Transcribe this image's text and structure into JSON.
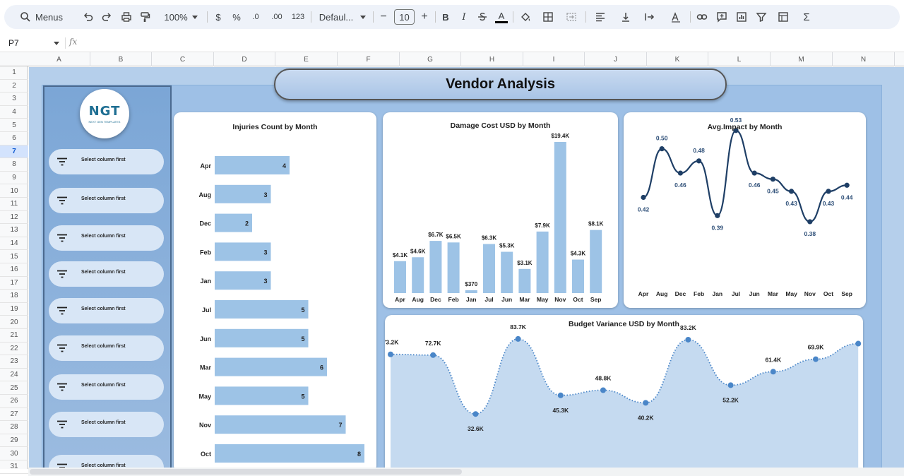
{
  "toolbar": {
    "search_label": "Menus",
    "zoom": "100%",
    "currency": "$",
    "percent": "%",
    "dec_decrease": ".0",
    "dec_increase": ".00",
    "number_format": "123",
    "font": "Defaul...",
    "font_size": "10",
    "bold": "B",
    "italic": "I",
    "text_color": "A",
    "sum": "Σ"
  },
  "formula_bar": {
    "cell": "P7",
    "fx": "fx"
  },
  "columns": [
    "A",
    "B",
    "C",
    "D",
    "E",
    "F",
    "G",
    "H",
    "I",
    "J",
    "K",
    "L",
    "M",
    "N"
  ],
  "rows": [
    "1",
    "2",
    "3",
    "4",
    "5",
    "6",
    "7",
    "8",
    "9",
    "10",
    "11",
    "12",
    "13",
    "14",
    "15",
    "16",
    "17",
    "18",
    "19",
    "20",
    "21",
    "22",
    "23",
    "24",
    "25",
    "26",
    "27",
    "28",
    "29",
    "30",
    "31"
  ],
  "active_row": "7",
  "dashboard": {
    "title": "Vendor Analysis",
    "logo_text": "NGT",
    "logo_subtext": "NEXT GEN TEMPLATES",
    "filters": [
      "Select column first",
      "Select column first",
      "Select column first",
      "Select column first",
      "Select column first",
      "Select column first",
      "Select column first",
      "Select column first",
      "Select column first"
    ]
  },
  "chart_data": [
    {
      "type": "bar",
      "orientation": "horizontal",
      "title": "Injuries Count by Month",
      "categories": [
        "Apr",
        "Aug",
        "Dec",
        "Feb",
        "Jan",
        "Jul",
        "Jun",
        "Mar",
        "May",
        "Nov",
        "Oct"
      ],
      "values": [
        4,
        3,
        2,
        3,
        3,
        5,
        5,
        6,
        5,
        7,
        8
      ],
      "data_labels": [
        "4",
        "3",
        "2",
        "3",
        "3",
        "5",
        "5",
        "6",
        "5",
        "7",
        "8"
      ],
      "color": "#9dc3e6"
    },
    {
      "type": "bar",
      "title": "Damage Cost USD by Month",
      "categories": [
        "Apr",
        "Aug",
        "Dec",
        "Feb",
        "Jan",
        "Jul",
        "Jun",
        "Mar",
        "May",
        "Nov",
        "Oct",
        "Sep"
      ],
      "values": [
        4100,
        4600,
        6700,
        6500,
        370,
        6300,
        5300,
        3100,
        7900,
        19400,
        4300,
        8100
      ],
      "data_labels": [
        "$4.1K",
        "$4.6K",
        "$6.7K",
        "$6.5K",
        "$370",
        "$6.3K",
        "$5.3K",
        "$3.1K",
        "$7.9K",
        "$19.4K",
        "$4.3K",
        "$8.1K"
      ],
      "color": "#9dc3e6"
    },
    {
      "type": "line",
      "title": "Avg.Impact by Month",
      "categories": [
        "Apr",
        "Aug",
        "Dec",
        "Feb",
        "Jan",
        "Jul",
        "Jun",
        "Mar",
        "May",
        "Nov",
        "Oct",
        "Sep"
      ],
      "values": [
        0.42,
        0.5,
        0.46,
        0.48,
        0.39,
        0.53,
        0.46,
        0.45,
        0.43,
        0.38,
        0.43,
        0.44
      ],
      "data_labels": [
        "0.42",
        "0.50",
        "0.46",
        "0.48",
        "0.39",
        "0.53",
        "0.46",
        "0.45",
        "0.43",
        "0.38",
        "0.43",
        "0.44"
      ],
      "ylim": [
        0.28,
        0.56
      ],
      "color": "#1f3f66"
    },
    {
      "type": "area",
      "title": "Budget Variance USD by Month",
      "values": [
        73200,
        72700,
        32600,
        83700,
        45300,
        48800,
        40200,
        83200,
        52200,
        61400,
        69900,
        80500
      ],
      "data_labels": [
        "73.2K",
        "72.7K",
        "32.6K",
        "83.7K",
        "45.3K",
        "48.8K",
        "40.2K",
        "83.2K",
        "52.2K",
        "61.4K",
        "69.9K",
        ""
      ],
      "ylim": [
        0,
        100000
      ],
      "color": "#4a86c8",
      "fill": "#c5daf0"
    }
  ]
}
